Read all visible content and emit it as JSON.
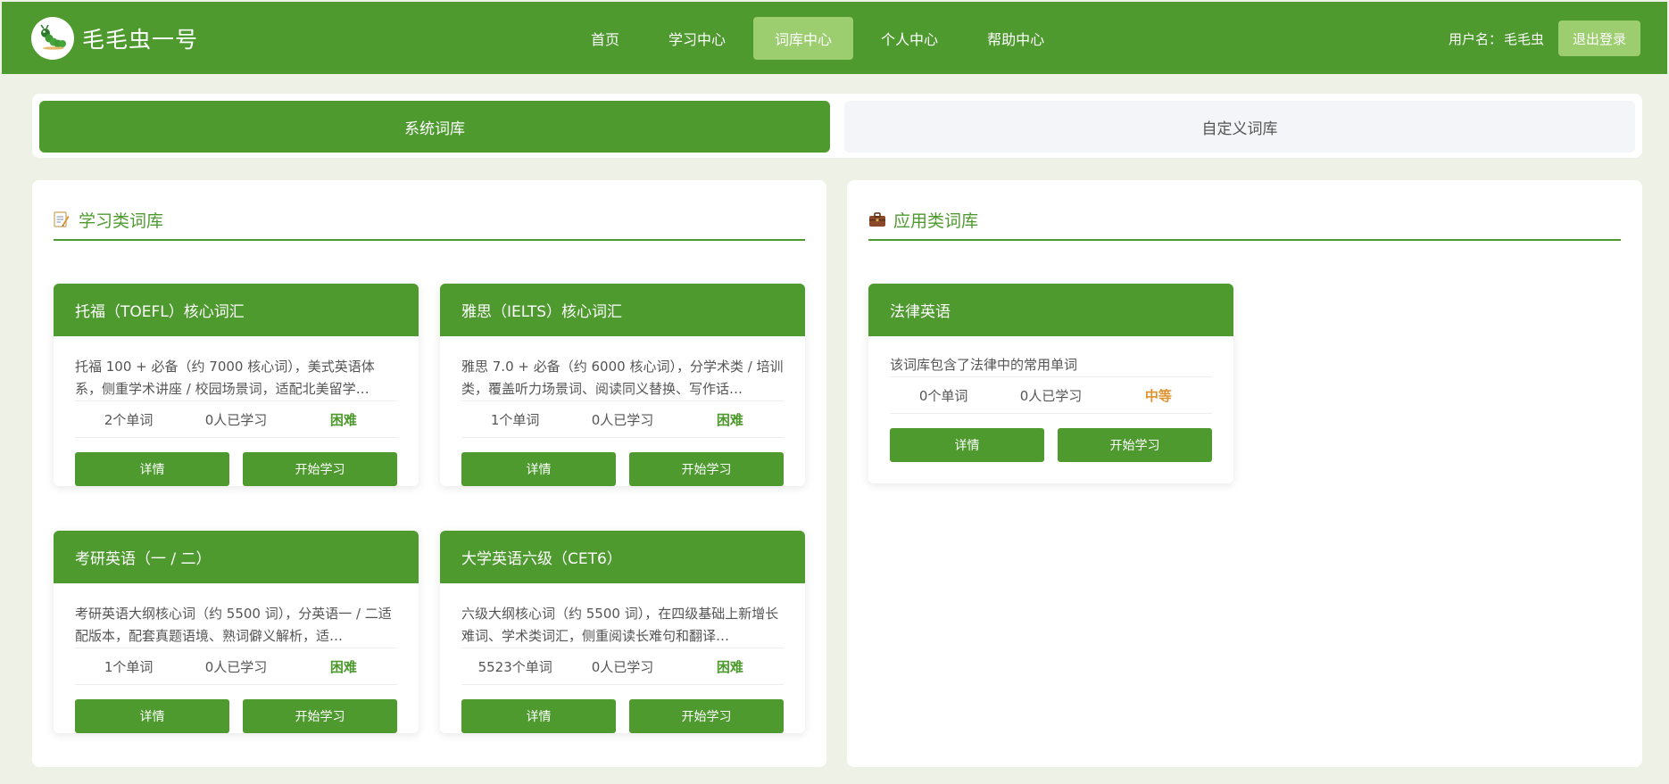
{
  "app": {
    "brand_name": "毛毛虫一号",
    "logo_icon": "caterpillar-icon"
  },
  "nav": {
    "items": [
      {
        "label": "首页"
      },
      {
        "label": "学习中心"
      },
      {
        "label": "词库中心",
        "active": true
      },
      {
        "label": "个人中心"
      },
      {
        "label": "帮助中心"
      }
    ]
  },
  "user": {
    "label": "用户名：",
    "name": "毛毛虫",
    "logout": "退出登录"
  },
  "tabs": {
    "system": "系统词库",
    "custom": "自定义词库"
  },
  "left_panel": {
    "title": "学习类词库",
    "icon": "memo-icon",
    "cards": [
      {
        "title": "托福（TOEFL）核心词汇",
        "desc": "托福 100 + 必备（约 7000 核心词），美式英语体系，侧重学术讲座 / 校园场景词，适配北美留学…",
        "words": "2个单词",
        "learners": "0人已学习",
        "level": "困难",
        "details": "详情",
        "start": "开始学习"
      },
      {
        "title": "雅思（IELTS）核心词汇",
        "desc": "雅思 7.0 + 必备（约 6000 核心词），分学术类 / 培训类，覆盖听力场景词、阅读同义替换、写作话…",
        "words": "1个单词",
        "learners": "0人已学习",
        "level": "困难",
        "details": "详情",
        "start": "开始学习"
      },
      {
        "title": "考研英语（一 / 二）",
        "desc": "考研英语大纲核心词（约 5500 词），分英语一 / 二适配版本，配套真题语境、熟词僻义解析，适…",
        "words": "1个单词",
        "learners": "0人已学习",
        "level": "困难",
        "details": "详情",
        "start": "开始学习"
      },
      {
        "title": "大学英语六级（CET6）",
        "desc": "六级大纲核心词（约 5500 词），在四级基础上新增长难词、学术类词汇，侧重阅读长难句和翻译…",
        "words": "5523个单词",
        "learners": "0人已学习",
        "level": "困难",
        "details": "详情",
        "start": "开始学习"
      }
    ]
  },
  "right_panel": {
    "title": "应用类词库",
    "icon": "briefcase-icon",
    "cards": [
      {
        "title": "法律英语",
        "desc": "该词库包含了法律中的常用单词",
        "words": "0个单词",
        "learners": "0人已学习",
        "level": "中等",
        "details": "详情",
        "start": "开始学习"
      }
    ]
  },
  "colors": {
    "primary": "#4e9a2f",
    "primary_light": "#9ccd6e",
    "level_hard": "#4e9a2f",
    "level_medium": "#e0922f"
  }
}
